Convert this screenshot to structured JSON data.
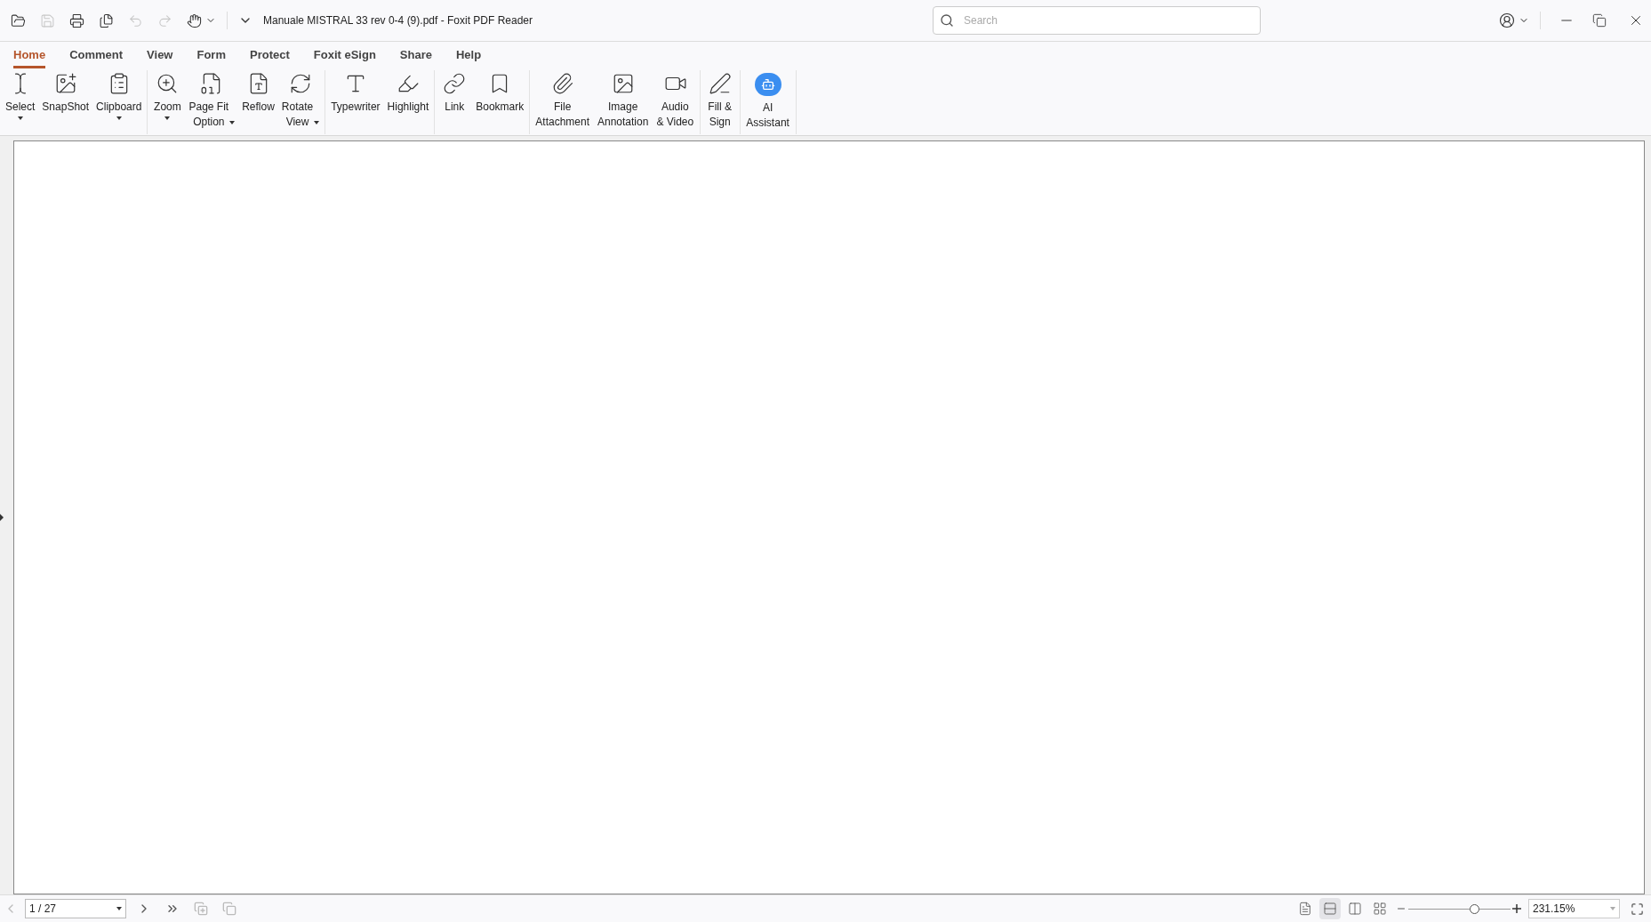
{
  "window": {
    "title": "Manuale MISTRAL 33 rev 0-4 (9).pdf - Foxit PDF Reader"
  },
  "quick_access": [
    {
      "kind": "open",
      "disabled": false
    },
    {
      "kind": "save",
      "disabled": true
    },
    {
      "kind": "print",
      "disabled": false
    },
    {
      "kind": "pages",
      "disabled": false
    },
    {
      "kind": "undo",
      "disabled": true
    },
    {
      "kind": "redo",
      "disabled": true
    },
    {
      "kind": "hand",
      "disabled": false
    }
  ],
  "search": {
    "placeholder": "Search"
  },
  "tabs": [
    {
      "label": "Home",
      "selected": true
    },
    {
      "label": "Comment",
      "selected": false
    },
    {
      "label": "View",
      "selected": false
    },
    {
      "label": "Form",
      "selected": false
    },
    {
      "label": "Protect",
      "selected": false
    },
    {
      "label": "Foxit eSign",
      "selected": false
    },
    {
      "label": "Share",
      "selected": false
    },
    {
      "label": "Help",
      "selected": false
    }
  ],
  "ribbon": {
    "groups": [
      {
        "items": [
          {
            "kind": "select",
            "lines": [
              "Select"
            ],
            "dropdown": true
          },
          {
            "kind": "snapshot",
            "lines": [
              "SnapShot"
            ],
            "dropdown": false
          },
          {
            "kind": "clipboard",
            "lines": [
              "Clipboard"
            ],
            "dropdown": true
          }
        ]
      },
      {
        "items": [
          {
            "kind": "zoom",
            "lines": [
              "Zoom"
            ],
            "dropdown": true
          },
          {
            "kind": "pagefit",
            "lines": [
              "Page Fit",
              "Option"
            ],
            "dropdown": true
          },
          {
            "kind": "reflow",
            "lines": [
              "Reflow"
            ],
            "dropdown": false
          },
          {
            "kind": "rotate",
            "lines": [
              "Rotate",
              "View"
            ],
            "dropdown": true
          }
        ]
      },
      {
        "items": [
          {
            "kind": "typewriter",
            "lines": [
              "Typewriter"
            ],
            "dropdown": false
          },
          {
            "kind": "highlight",
            "lines": [
              "Highlight"
            ],
            "dropdown": false
          }
        ]
      },
      {
        "items": [
          {
            "kind": "link",
            "lines": [
              "Link"
            ],
            "dropdown": false
          },
          {
            "kind": "bookmark",
            "lines": [
              "Bookmark"
            ],
            "dropdown": false
          }
        ]
      },
      {
        "items": [
          {
            "kind": "attachment",
            "lines": [
              "File",
              "Attachment"
            ],
            "dropdown": false
          },
          {
            "kind": "image",
            "lines": [
              "Image",
              "Annotation"
            ],
            "dropdown": false
          },
          {
            "kind": "video",
            "lines": [
              "Audio",
              "& Video"
            ],
            "dropdown": false
          }
        ]
      },
      {
        "items": [
          {
            "kind": "sign",
            "lines": [
              "Fill &",
              "Sign"
            ],
            "dropdown": false
          }
        ]
      },
      {
        "items": [
          {
            "kind": "ai",
            "lines": [
              "AI",
              "Assistant"
            ],
            "dropdown": false
          }
        ]
      }
    ]
  },
  "status_bar": {
    "page": "1 / 27",
    "view_modes": [
      {
        "kind": "single",
        "selected": false
      },
      {
        "kind": "continuous",
        "selected": true
      },
      {
        "kind": "facing",
        "selected": false
      },
      {
        "kind": "cont-facing",
        "selected": false
      }
    ],
    "zoom": {
      "level": 0.64,
      "value": "231.15%"
    }
  }
}
